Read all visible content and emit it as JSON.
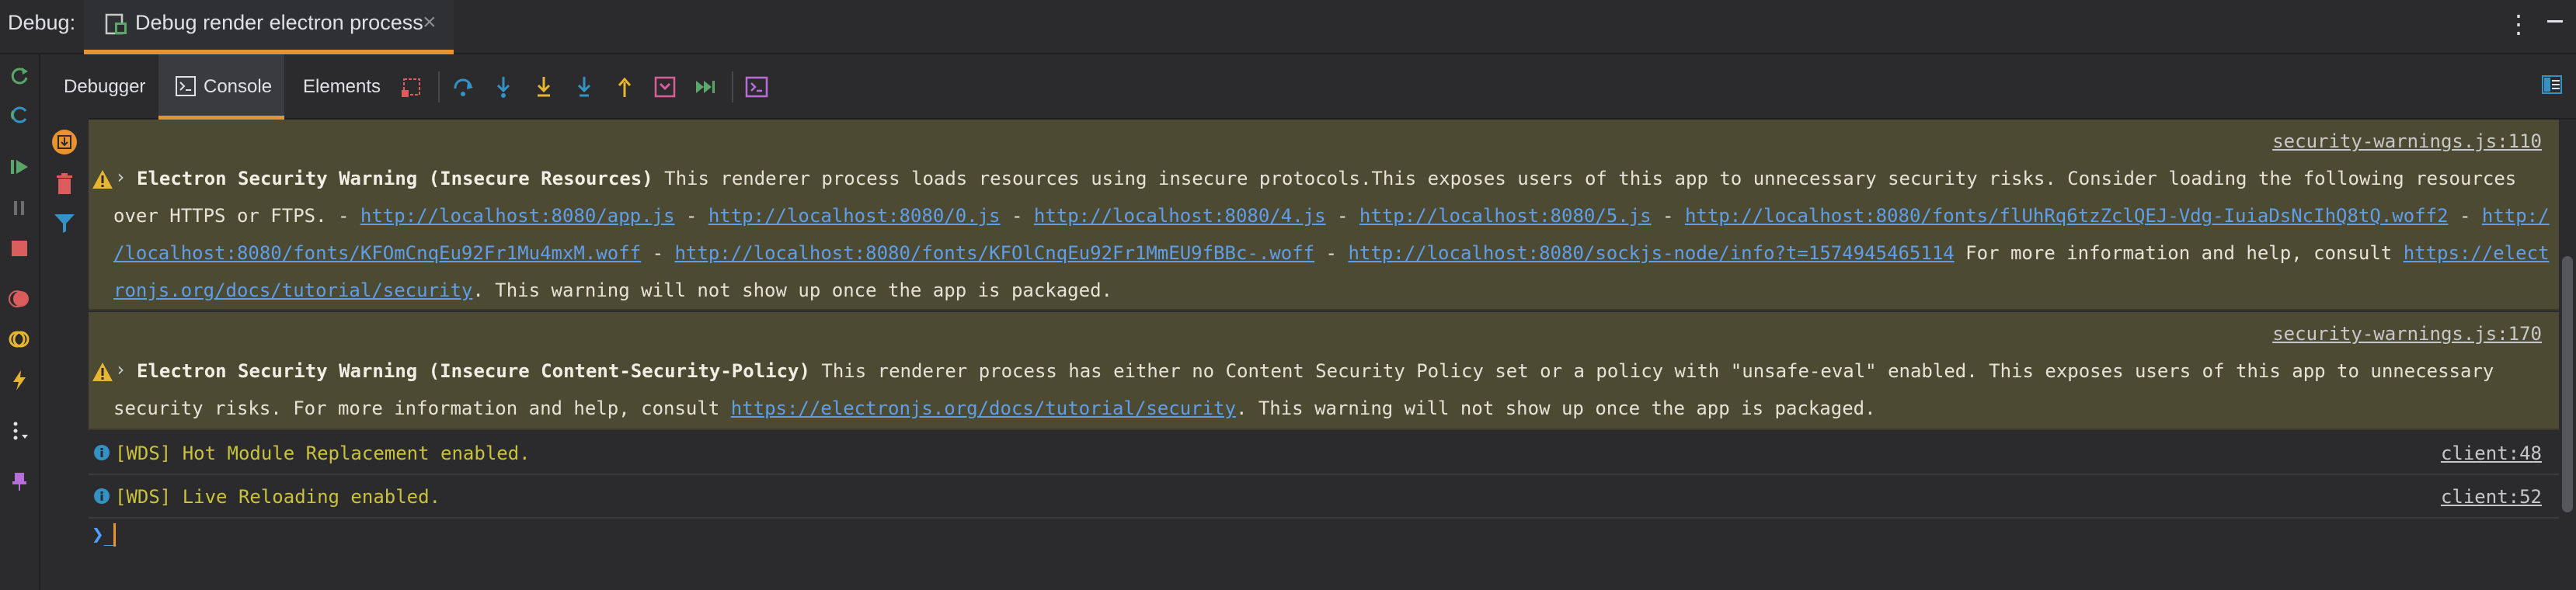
{
  "topbar": {
    "debug_label": "Debug:",
    "tab_label": "Debug render electron process",
    "tab_close": "×"
  },
  "toolbar": {
    "tabs": [
      {
        "label": "Debugger"
      },
      {
        "label": "Console"
      },
      {
        "label": "Elements"
      }
    ]
  },
  "console": {
    "warnings": [
      {
        "source": "security-warnings.js:110",
        "title": "Electron Security Warning (Insecure Resources)",
        "text_1": " This renderer process loads resources using insecure protocols.This exposes users of this app to unnecessary security risks. Consider loading the following resources",
        "line_2_prefix": "over HTTPS or FTPS. - ",
        "link_app": "http://localhost:8080/app.js",
        "sep": " - ",
        "link_0": "http://localhost:8080/0.js",
        "link_4": "http://localhost:8080/4.js",
        "link_5": "http://localhost:8080/5.js",
        "link_font1": "http://localhost:8080/fonts/flUhRq6tzZclQEJ-Vdg-IuiaDsNcIhQ8tQ.woff2",
        "link_font2_a": "http:/",
        "link_font2_b": "/localhost:8080/fonts/KFOmCnqEu92Fr1Mu4mxM.woff",
        "link_font3": "http://localhost:8080/fonts/KFOlCnqEu92Fr1MmEU9fBBc-.woff",
        "link_sockjs": "http://localhost:8080/sockjs-node/info?t=1574945465114",
        "more_info": " For more information and help, consult ",
        "link_docs_a": "https://elect",
        "link_docs_b": "ronjs.org/docs/tutorial/security",
        "tail": ". This warning will not show up once the app is packaged."
      },
      {
        "source": "security-warnings.js:170",
        "title": "Electron Security Warning (Insecure Content-Security-Policy)",
        "text_1": " This renderer process has either no Content Security Policy set or a policy with \"unsafe-eval\" enabled. This exposes users of this app to unnecessary",
        "line_2_prefix": "security risks. For more information and help, consult ",
        "link_docs": "https://electronjs.org/docs/tutorial/security",
        "tail": ". This warning will not show up once the app is packaged."
      }
    ],
    "infos": [
      {
        "text": "[WDS] Hot Module Replacement enabled.",
        "source": "client:48"
      },
      {
        "text": "[WDS] Live Reloading enabled.",
        "source": "client:52"
      }
    ],
    "prompt": "❯_"
  },
  "colors": {
    "accent": "#e8932f",
    "warning_bg": "#4d4a33",
    "info_text": "#c9c23b",
    "link": "#5f9ee8"
  }
}
